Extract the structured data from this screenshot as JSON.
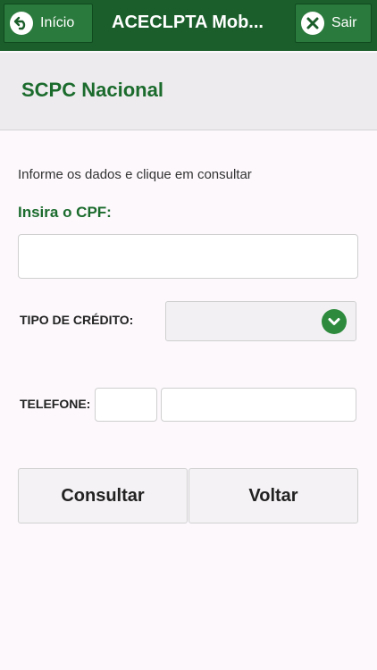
{
  "header": {
    "back_label": "Início",
    "title": "ACECLPTA Mob...",
    "exit_label": "Sair"
  },
  "subheader": {
    "title": "SCPC Nacional"
  },
  "form": {
    "instructions": "Informe os dados e clique em consultar",
    "cpf_label": "Insira o CPF:",
    "cpf_value": "",
    "credit_type_label": "TIPO DE CRÉDITO:",
    "credit_type_selected": "",
    "phone_label": "TELEFONE:",
    "phone_ddd_value": "",
    "phone_number_value": ""
  },
  "actions": {
    "consult_label": "Consultar",
    "back_label": "Voltar"
  },
  "colors": {
    "topbar": "#1b5e2b",
    "accent_green": "#1b6b2d",
    "chevron_green": "#2e8b3e"
  },
  "icons": {
    "back": "back-arrow-icon",
    "exit": "close-icon",
    "dropdown": "chevron-down-icon"
  }
}
